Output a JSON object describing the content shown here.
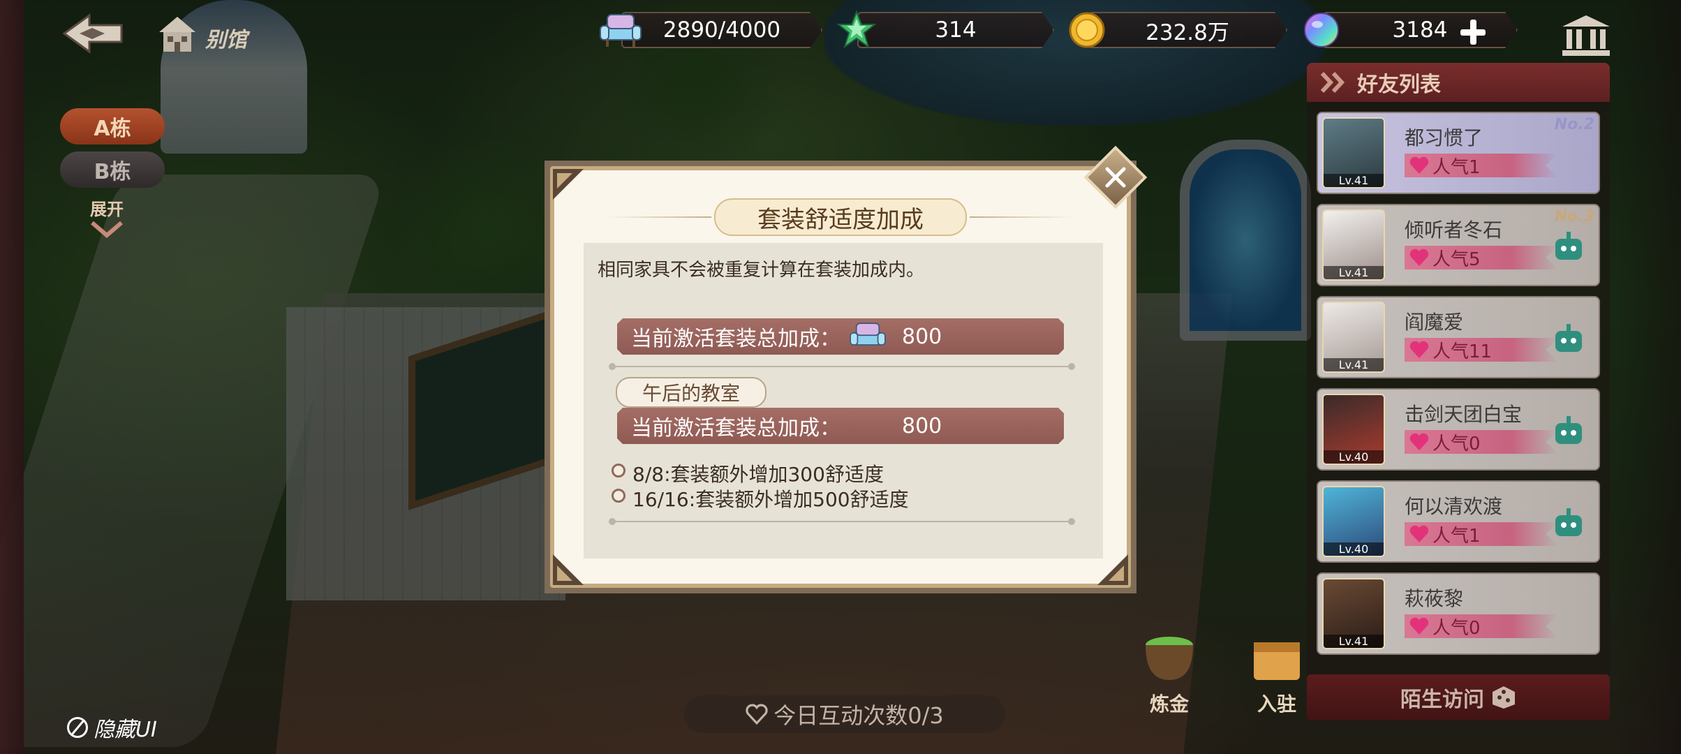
{
  "top": {
    "annex_label": "别馆",
    "resources": [
      {
        "icon": "sofa-icon",
        "value": "2890/4000"
      },
      {
        "icon": "star-icon",
        "value": "314"
      },
      {
        "icon": "gold-coin-icon",
        "value": "232.8万"
      },
      {
        "icon": "rainbow-gem-icon",
        "value": "3184"
      }
    ]
  },
  "left": {
    "tab_a": "A栋",
    "tab_b": "B栋",
    "expand": "展开",
    "hide_ui": "隐藏UI"
  },
  "friends": {
    "title": "好友列表",
    "items": [
      {
        "name": "都习惯了",
        "popularity": "人气1",
        "level": "Lv.41",
        "rank": "No.2"
      },
      {
        "name": "倾听者冬石",
        "popularity": "人气5",
        "level": "Lv.41",
        "rank": "No.3"
      },
      {
        "name": "阎魔爱",
        "popularity": "人气11",
        "level": "Lv.41"
      },
      {
        "name": "击剑天团白宝",
        "popularity": "人气0",
        "level": "Lv.40"
      },
      {
        "name": "何以清欢渡",
        "popularity": "人气1",
        "level": "Lv.40"
      },
      {
        "name": "萩莜黎",
        "popularity": "人气0",
        "level": "Lv.41"
      }
    ],
    "stranger_visit": "陌生访问"
  },
  "bottom": {
    "interact_count": "今日互动次数0/3",
    "alchemy": "炼金",
    "move_in": "入驻"
  },
  "modal": {
    "title": "套装舒适度加成",
    "note": "相同家具不会被重复计算在套装加成内。",
    "total_label": "当前激活套装总加成：",
    "total_value": "800",
    "set_name": "午后的教室",
    "set_label": "当前激活套装总加成：",
    "set_value": "800",
    "conditions": [
      "8/8:套装额外增加300舒适度",
      "16/16:套装额外增加500舒适度"
    ]
  },
  "colors": {
    "bar": "#9a645d",
    "modal_bg": "#faf6ec",
    "popularity_pink": "#d97894"
  }
}
